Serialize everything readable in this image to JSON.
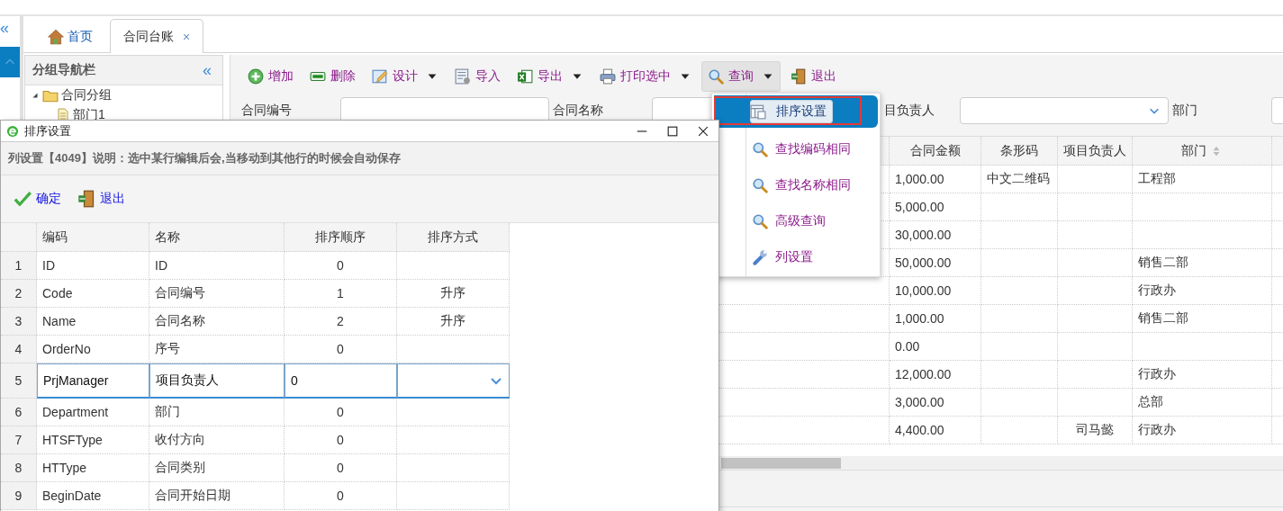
{
  "sidebar": {
    "collapse": "«"
  },
  "tabs": [
    {
      "label": "首页",
      "kind": "home",
      "selected": false
    },
    {
      "label": "合同台账",
      "kind": "plain",
      "selected": true,
      "close": "×"
    }
  ],
  "nav": {
    "title": "分组导航栏",
    "collapse": "«",
    "tree": [
      {
        "label": "合同分组",
        "expanded": true,
        "children": [
          {
            "label": "部门1"
          }
        ]
      }
    ]
  },
  "toolbar": [
    {
      "label": "增加",
      "kind": "add",
      "dropdown": false,
      "active": false
    },
    {
      "label": "删除",
      "kind": "del",
      "dropdown": false,
      "active": false
    },
    {
      "label": "设计",
      "kind": "design",
      "dropdown": true,
      "active": false
    },
    {
      "label": "导入",
      "kind": "import",
      "dropdown": false,
      "active": false
    },
    {
      "label": "导出",
      "kind": "export",
      "dropdown": true,
      "active": false
    },
    {
      "label": "打印选中",
      "kind": "print",
      "dropdown": true,
      "active": false
    },
    {
      "label": "查询",
      "kind": "search",
      "dropdown": true,
      "active": true
    },
    {
      "label": "退出",
      "kind": "exit",
      "dropdown": false,
      "active": false
    }
  ],
  "search": [
    {
      "label": "合同编号",
      "kind": "text"
    },
    {
      "label": "合同名称",
      "kind": "text"
    },
    {
      "label": "目负责人",
      "kind": "select"
    },
    {
      "label": "部门",
      "kind": "text"
    }
  ],
  "grid": {
    "columns": [
      {
        "label": "合同金额",
        "sortable": false
      },
      {
        "label": "条形码",
        "sortable": false
      },
      {
        "label": "项目负责人",
        "sortable": false
      },
      {
        "label": "部门",
        "sortable": true
      }
    ],
    "rows": [
      {
        "amount": "1,000.00",
        "barcode": "中文二维码",
        "dept": "工程部"
      },
      {
        "amount": "5,000.00"
      },
      {
        "amount": "30,000.00"
      },
      {
        "amount": "50,000.00",
        "dept": "销售二部"
      },
      {
        "amount": "10,000.00",
        "dept": "行政办"
      },
      {
        "amount": "1,000.00",
        "dept": "销售二部"
      },
      {
        "amount": "0.00"
      },
      {
        "amount": "12,000.00",
        "dept": "行政办"
      },
      {
        "amount": "3,000.00",
        "dept": "总部"
      },
      {
        "amount": "4,400.00",
        "manager": "司马懿",
        "dept": "行政办"
      }
    ]
  },
  "menu": {
    "items": [
      {
        "label": "排序设置",
        "kind": "sortset",
        "selected": true
      },
      {
        "label": "查找编码相同",
        "kind": "search",
        "selected": false
      },
      {
        "label": "查找名称相同",
        "kind": "search",
        "selected": false
      },
      {
        "label": "高级查询",
        "kind": "search",
        "selected": false
      },
      {
        "label": "列设置",
        "kind": "wrench",
        "selected": false
      }
    ]
  },
  "dialog": {
    "title": "排序设置",
    "info": "列设置【4049】说明：选中某行编辑后会,当移动到其他行的时候会自动保存",
    "buttons": [
      {
        "label": "确定",
        "kind": "check"
      },
      {
        "label": "退出",
        "kind": "exit"
      }
    ],
    "columns": [
      "编码",
      "名称",
      "排序顺序",
      "排序方式"
    ],
    "rows": [
      {
        "num": "1",
        "code": "ID",
        "name": "ID",
        "order": "0",
        "editing": false
      },
      {
        "num": "2",
        "code": "Code",
        "name": "合同编号",
        "order": "1",
        "direction": "升序",
        "editing": false
      },
      {
        "num": "3",
        "code": "Name",
        "name": "合同名称",
        "order": "2",
        "direction": "升序",
        "editing": false
      },
      {
        "num": "4",
        "code": "OrderNo",
        "name": "序号",
        "order": "0",
        "editing": false
      },
      {
        "num": "5",
        "code": "PrjManager",
        "name": "项目负责人",
        "order": "0",
        "editing": true
      },
      {
        "num": "6",
        "code": "Department",
        "name": "部门",
        "order": "0",
        "editing": false
      },
      {
        "num": "7",
        "code": "HTSFType",
        "name": "收付方向",
        "order": "0",
        "editing": false
      },
      {
        "num": "8",
        "code": "HTType",
        "name": "合同类别",
        "order": "0",
        "editing": false
      },
      {
        "num": "9",
        "code": "BeginDate",
        "name": "合同开始日期",
        "order": "0",
        "editing": false
      }
    ]
  }
}
